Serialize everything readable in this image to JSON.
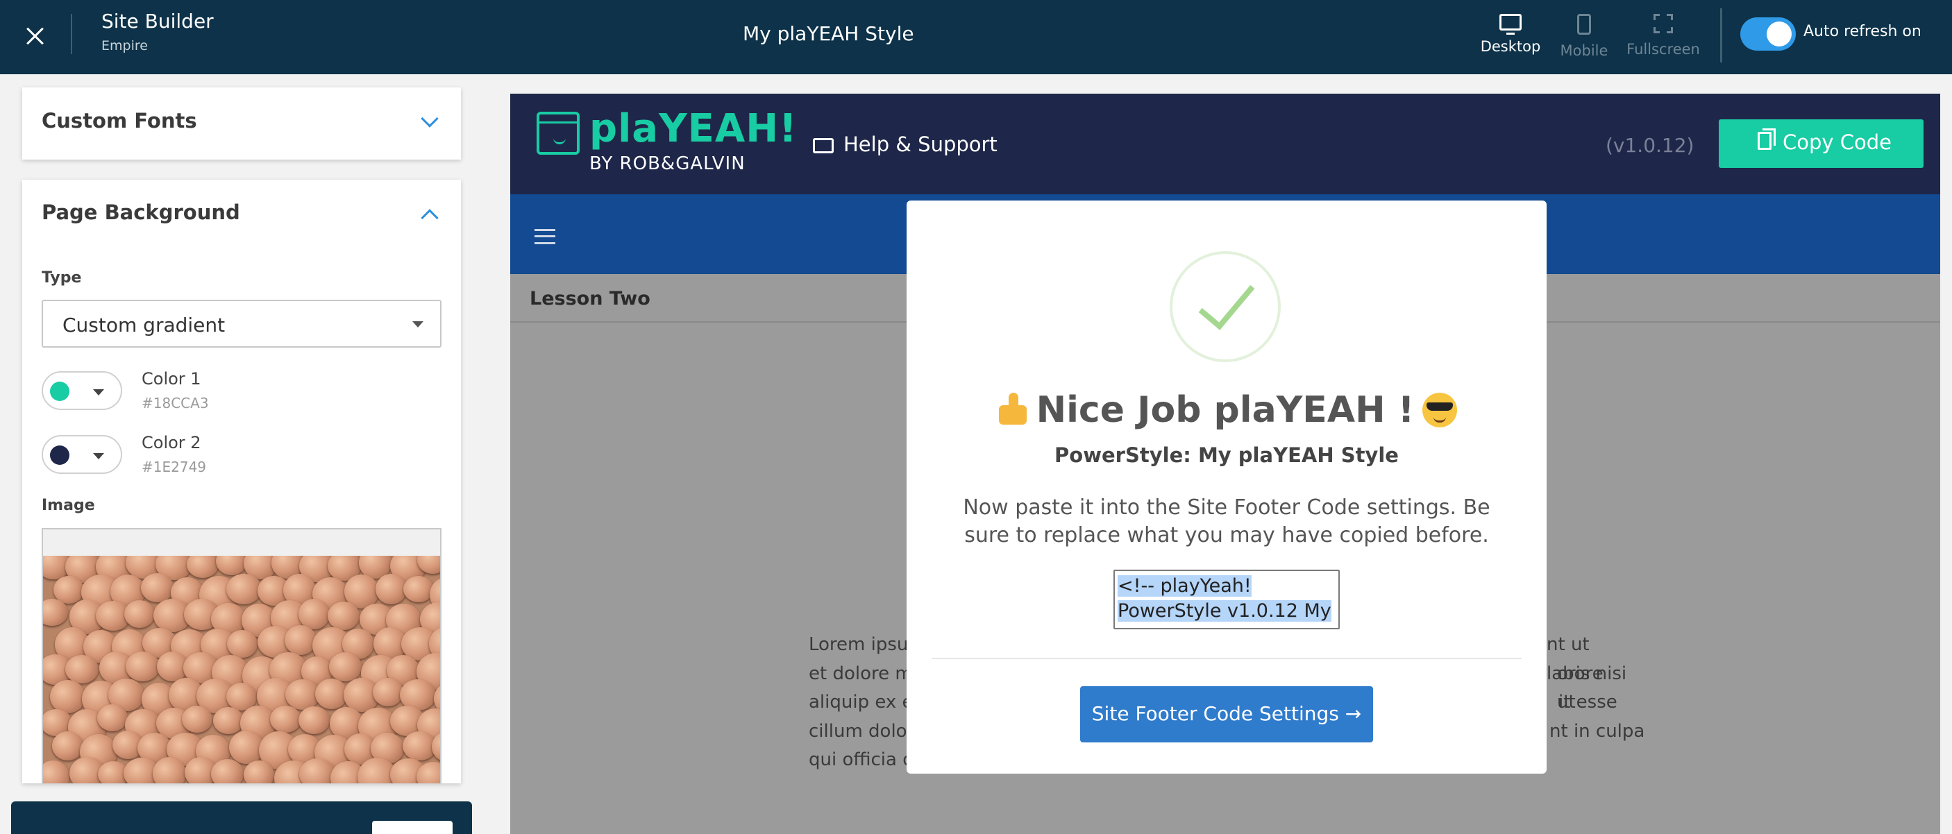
{
  "topbar": {
    "app_title": "Site Builder",
    "app_subtitle": "Empire",
    "page_title": "My plaYEAH Style",
    "devices": [
      {
        "label": "Desktop",
        "active": true
      },
      {
        "label": "Mobile",
        "active": false
      },
      {
        "label": "Fullscreen",
        "active": false
      }
    ],
    "auto_refresh_label": "Auto refresh on",
    "auto_refresh_on": true
  },
  "sidebar": {
    "custom_fonts_title": "Custom Fonts",
    "page_background_title": "Page Background",
    "type_label": "Type",
    "type_value": "Custom gradient",
    "colors": [
      {
        "name": "Color 1",
        "hex": "#18CCA3"
      },
      {
        "name": "Color 2",
        "hex": "#1E2749"
      }
    ],
    "image_label": "Image"
  },
  "preview": {
    "logo_name": "plaYEAH!",
    "logo_by": "BY ROB&GALVIN",
    "help_label": "Help & Support",
    "version": "(v1.0.12)",
    "copy_button": "Copy Code",
    "lesson_title": "Lesson Two",
    "lorem_lines": [
      "Lorem ipsum",
      "et dolore ma",
      "aliquip ex ea",
      "cillum dolor",
      "qui officia d"
    ],
    "lorem_right": [
      "nt ut labore",
      "oris nisi ut",
      "it esse",
      "nt in culpa"
    ]
  },
  "modal": {
    "title": "Nice Job plaYEAH !",
    "subtitle": "PowerStyle: My plaYEAH Style",
    "instructions": "Now paste it into the Site Footer Code settings. Be sure to replace what you may have copied before.",
    "code_line1": "<!-- playYeah!",
    "code_line2": "PowerStyle v1.0.12 My",
    "footer_button": "Site Footer Code Settings →"
  }
}
